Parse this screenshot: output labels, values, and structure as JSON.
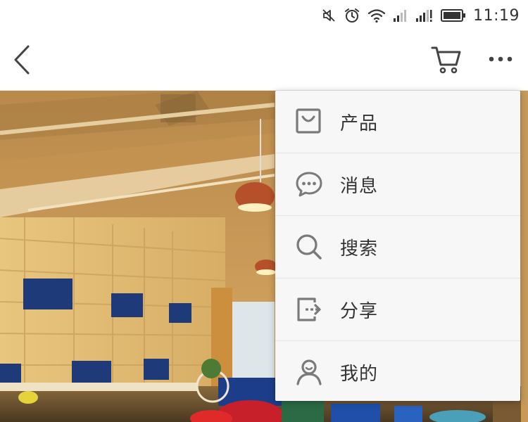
{
  "status_bar": {
    "time": "11:19",
    "icons": [
      "mute-icon",
      "alarm-icon",
      "wifi-icon",
      "signal-icon",
      "signal-icon",
      "battery-icon"
    ]
  },
  "nav_bar": {
    "back_icon": "chevron-left-icon",
    "cart_icon": "cart-icon",
    "more_icon": "more-icon"
  },
  "colors": {
    "icon_gray": "#7a7a7a",
    "text": "#333333",
    "menu_bg": "#f7f7f7",
    "divider": "#e4e4e4"
  },
  "menu": {
    "items": [
      {
        "label": "产品",
        "icon": "bag-icon"
      },
      {
        "label": "消息",
        "icon": "chat-bubble-icon"
      },
      {
        "label": "搜索",
        "icon": "search-icon"
      },
      {
        "label": "分享",
        "icon": "share-icon"
      },
      {
        "label": "我的",
        "icon": "user-icon"
      }
    ]
  }
}
